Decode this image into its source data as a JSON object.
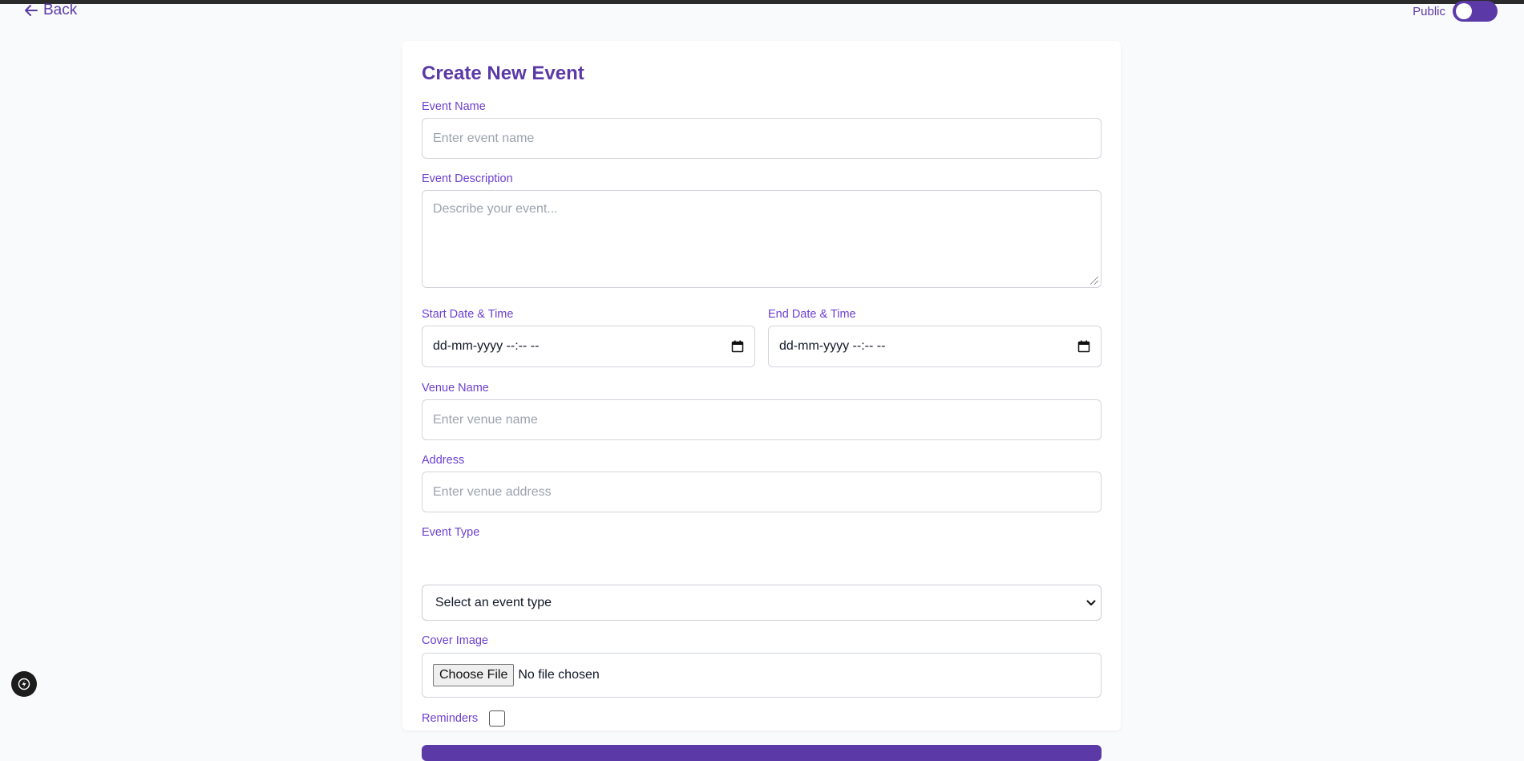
{
  "nav": {
    "back_label": "Back"
  },
  "visibility": {
    "label": "Public",
    "is_on": true
  },
  "form": {
    "title": "Create New Event",
    "event_name": {
      "label": "Event Name",
      "placeholder": "Enter event name",
      "value": ""
    },
    "event_description": {
      "label": "Event Description",
      "placeholder": "Describe your event...",
      "value": ""
    },
    "start_datetime": {
      "label": "Start Date & Time",
      "display": "dd-mm-yyyy --:-- --"
    },
    "end_datetime": {
      "label": "End Date & Time",
      "display": "dd-mm-yyyy --:-- --"
    },
    "venue_name": {
      "label": "Venue Name",
      "placeholder": "Enter venue name",
      "value": ""
    },
    "address": {
      "label": "Address",
      "placeholder": "Enter venue address",
      "value": ""
    },
    "event_type": {
      "label": "Event Type",
      "selected": "Select an event type"
    },
    "cover_image": {
      "label": "Cover Image",
      "button_label": "Choose File",
      "status": "No file chosen"
    },
    "reminders": {
      "label": "Reminders",
      "checked": false
    }
  },
  "colors": {
    "brand": "#5b3aa8",
    "label": "#6d3fd0",
    "page_background": "#f9fafb",
    "border": "#d1d5db"
  },
  "icons": {
    "back": "arrow-left-icon",
    "calendar": "calendar-icon",
    "dropdown": "chevron-down-icon",
    "floating_action": "lightning-icon"
  }
}
